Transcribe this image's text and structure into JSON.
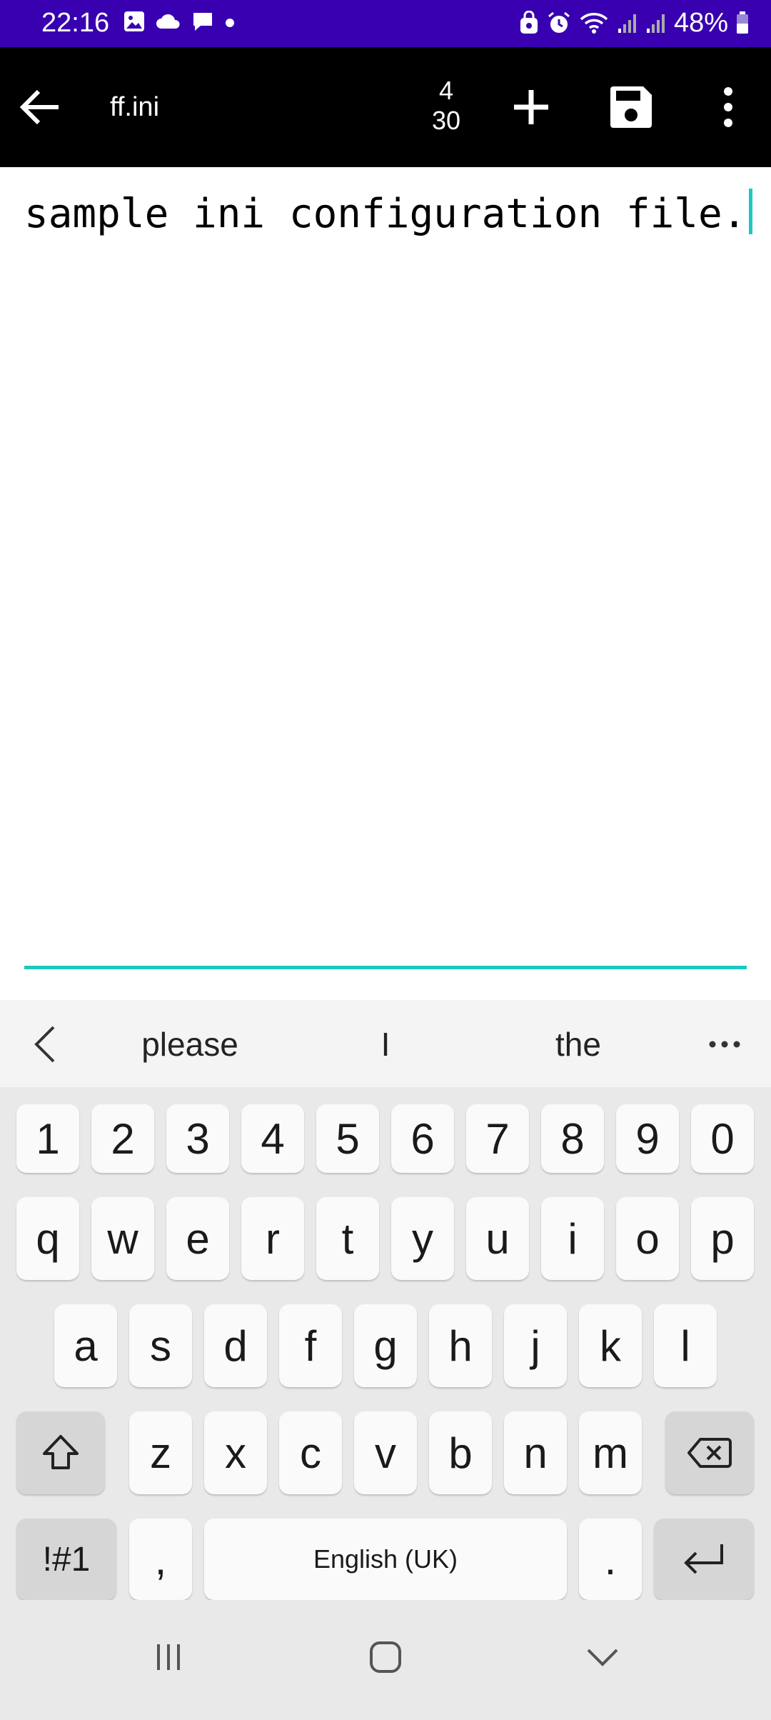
{
  "colors": {
    "status_bar": "#3800b0",
    "app_bar": "#000000",
    "accent": "#1ec8c0",
    "keyboard_bg": "#e9e9e9"
  },
  "status_bar": {
    "time": "22:16",
    "left_icons": [
      "gallery-icon",
      "cloud-icon",
      "chat-bubble-icon",
      "dot-icon"
    ],
    "right_icons": [
      "security-icon",
      "alarm-icon",
      "wifi-icon",
      "signal-icon",
      "signal-icon",
      "battery-icon"
    ],
    "battery": "48%"
  },
  "app_bar": {
    "title": "ff.ini",
    "line": "4",
    "column": "30",
    "icons": [
      "back-arrow-icon",
      "plus-icon",
      "save-icon",
      "more-vert-icon"
    ]
  },
  "editor": {
    "text": "sample ini configuration file."
  },
  "keyboard": {
    "suggestions": [
      "please",
      "I",
      "the"
    ],
    "number_row": [
      "1",
      "2",
      "3",
      "4",
      "5",
      "6",
      "7",
      "8",
      "9",
      "0"
    ],
    "row1": [
      "q",
      "w",
      "e",
      "r",
      "t",
      "y",
      "u",
      "i",
      "o",
      "p"
    ],
    "row2": [
      "a",
      "s",
      "d",
      "f",
      "g",
      "h",
      "j",
      "k",
      "l"
    ],
    "row3": [
      "z",
      "x",
      "c",
      "v",
      "b",
      "n",
      "m"
    ],
    "symbols_key": "!#1",
    "comma_key": ",",
    "space_label": "English (UK)",
    "period_key": "."
  },
  "nav_bar": {
    "icons": [
      "recents-icon",
      "home-icon",
      "hide-keyboard-icon"
    ]
  }
}
